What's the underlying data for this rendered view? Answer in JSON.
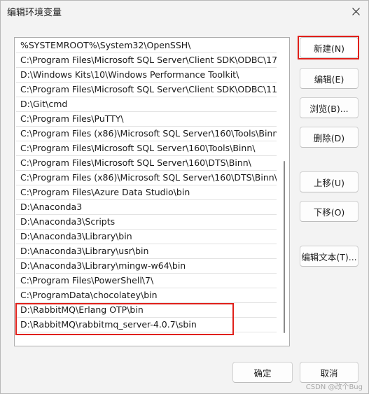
{
  "window": {
    "title": "编辑环境变量",
    "close_symbol": "✕"
  },
  "paths": [
    "%SYSTEMROOT%\\System32\\OpenSSH\\",
    "C:\\Program Files\\Microsoft SQL Server\\Client SDK\\ODBC\\17...",
    "D:\\Windows Kits\\10\\Windows Performance Toolkit\\",
    "C:\\Program Files\\Microsoft SQL Server\\Client SDK\\ODBC\\11...",
    "D:\\Git\\cmd",
    "C:\\Program Files\\PuTTY\\",
    "C:\\Program Files (x86)\\Microsoft SQL Server\\160\\Tools\\Binn\\",
    "C:\\Program Files\\Microsoft SQL Server\\160\\Tools\\Binn\\",
    "C:\\Program Files\\Microsoft SQL Server\\160\\DTS\\Binn\\",
    "C:\\Program Files (x86)\\Microsoft SQL Server\\160\\DTS\\Binn\\",
    "C:\\Program Files\\Azure Data Studio\\bin",
    "D:\\Anaconda3",
    "D:\\Anaconda3\\Scripts",
    "D:\\Anaconda3\\Library\\bin",
    "D:\\Anaconda3\\Library\\usr\\bin",
    "D:\\Anaconda3\\Library\\mingw-w64\\bin",
    "C:\\Program Files\\PowerShell\\7\\",
    "C:\\ProgramData\\chocolatey\\bin",
    "D:\\RabbitMQ\\Erlang OTP\\bin",
    "D:\\RabbitMQ\\rabbitmq_server-4.0.7\\sbin"
  ],
  "buttons": {
    "new": "新建(N)",
    "edit": "编辑(E)",
    "browse": "浏览(B)...",
    "delete": "删除(D)",
    "move_up": "上移(U)",
    "move_down": "下移(O)",
    "edit_text": "编辑文本(T)...",
    "ok": "确定",
    "cancel": "取消"
  },
  "watermark": "CSDN @改个Bug",
  "colors": {
    "highlight": "#e0201a",
    "background": "#f3f3f3"
  }
}
